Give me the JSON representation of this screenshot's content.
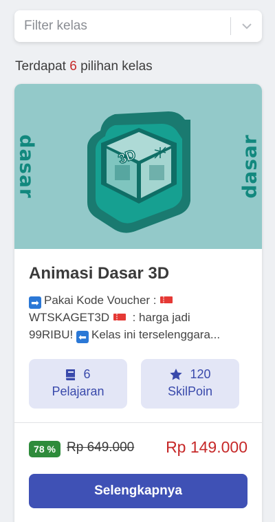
{
  "filter": {
    "placeholder": "Filter kelas"
  },
  "summary": {
    "prefix": "Terdapat",
    "count": "6",
    "suffix": "pilihan kelas"
  },
  "course": {
    "thumbnail": {
      "side_text": "dasar",
      "badge_text": "3D"
    },
    "title": "Animasi Dasar 3D",
    "description": {
      "line1": "Pakai Kode Voucher :",
      "code": "WTSKAGET3D",
      "line2": ": harga jadi",
      "line3": "99RIBU!",
      "line4": "Kelas ini terselenggara..."
    },
    "stats": [
      {
        "icon": "book-icon",
        "value": "6",
        "label": "Pelajaran"
      },
      {
        "icon": "star-icon",
        "value": "120",
        "label": "SkilPoin"
      }
    ],
    "discount": "78 %",
    "old_price": "Rp 649.000",
    "new_price": "Rp 149.000",
    "cta_label": "Selengkapnya"
  },
  "colors": {
    "accent": "#3f51b5",
    "price": "#c62828",
    "discount_badge": "#2e8b3b",
    "thumbnail_bg": "#93c9c9",
    "thumbnail_fg": "#12887e"
  }
}
